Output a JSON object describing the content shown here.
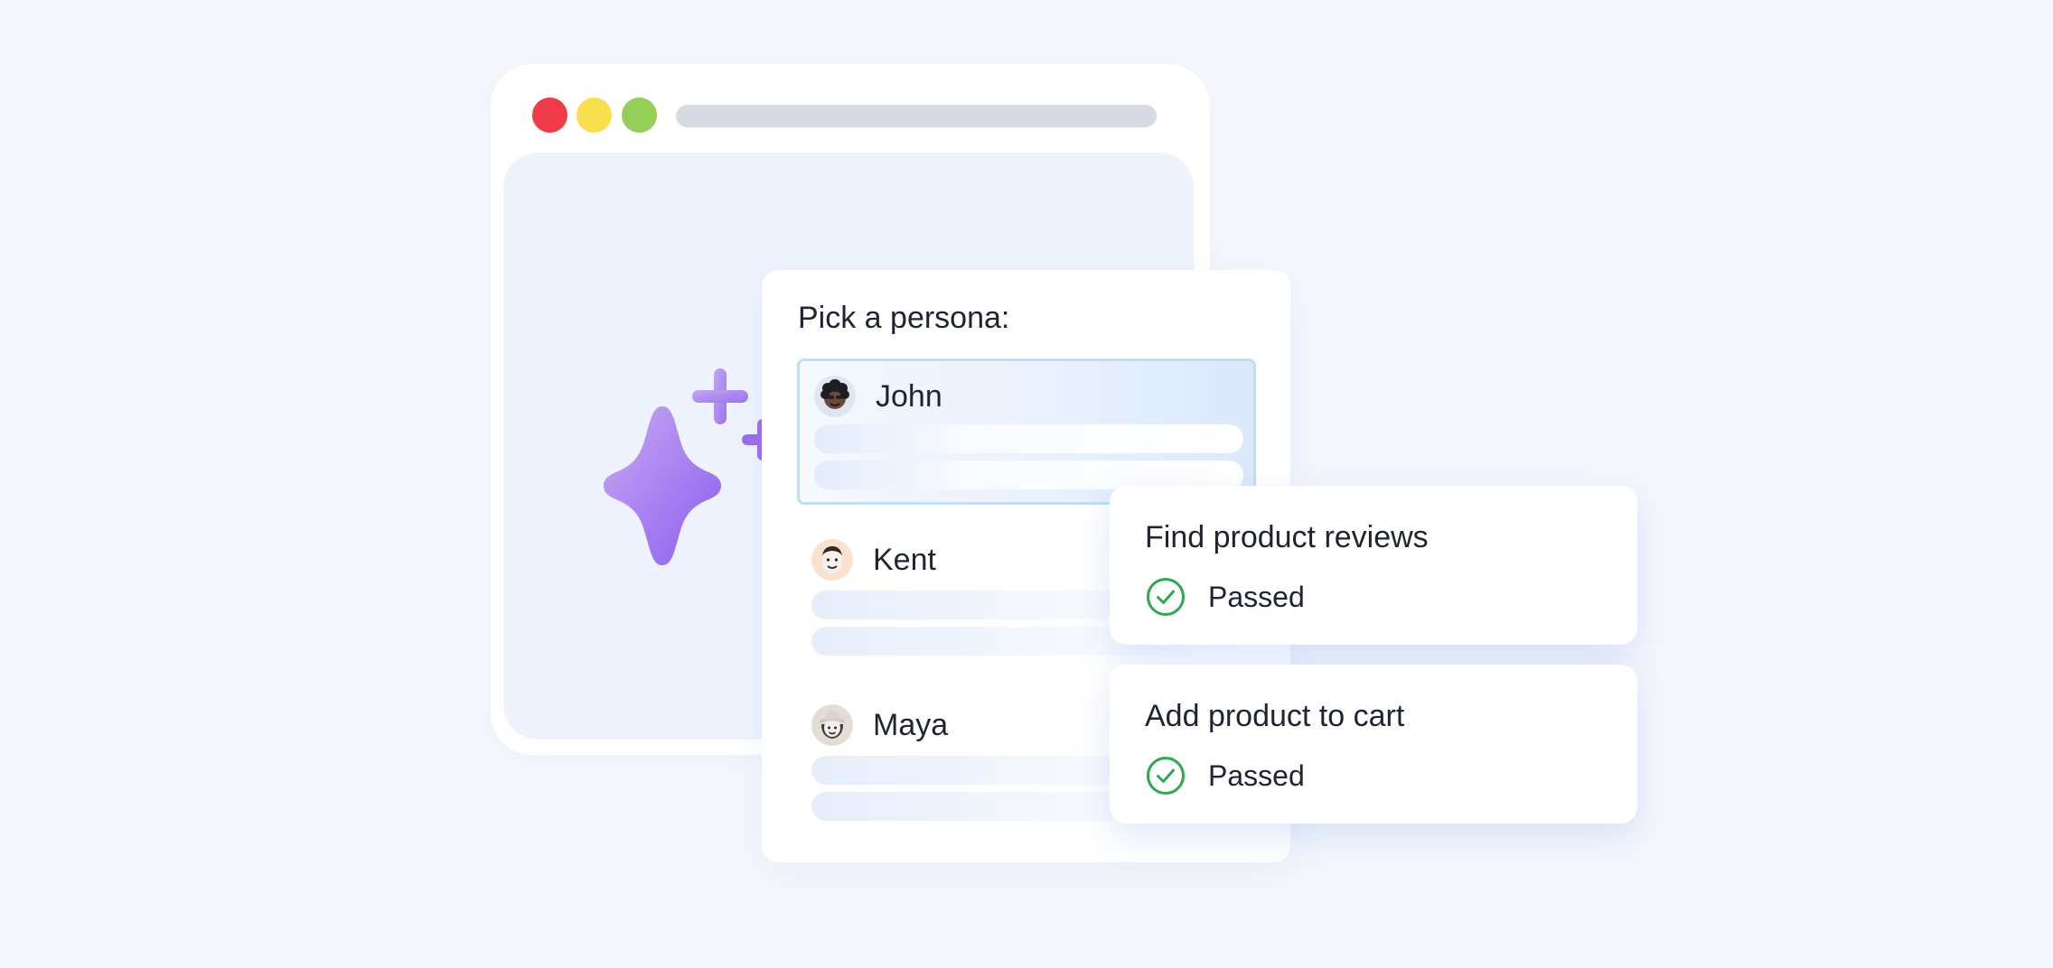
{
  "colors": {
    "background": "#f5f7fc",
    "window_red": "#ef3a47",
    "window_yellow": "#fadf4c",
    "window_green": "#95cf57",
    "sparkle_purple": "#9a6cf0",
    "pass_green": "#2fa84f",
    "selected_border": "#c4dcf4"
  },
  "persona_picker": {
    "title": "Pick a persona:",
    "personas": [
      {
        "name": "John",
        "avatar_icon": "curly-hair-avatar-icon",
        "selected": true
      },
      {
        "name": "Kent",
        "avatar_icon": "smiling-man-avatar-icon",
        "selected": false
      },
      {
        "name": "Maya",
        "avatar_icon": "hat-woman-avatar-icon",
        "selected": false
      }
    ]
  },
  "results": [
    {
      "title": "Find product reviews",
      "status": "Passed",
      "status_icon": "check-circle-icon"
    },
    {
      "title": "Add product to cart",
      "status": "Passed",
      "status_icon": "check-circle-icon"
    }
  ]
}
